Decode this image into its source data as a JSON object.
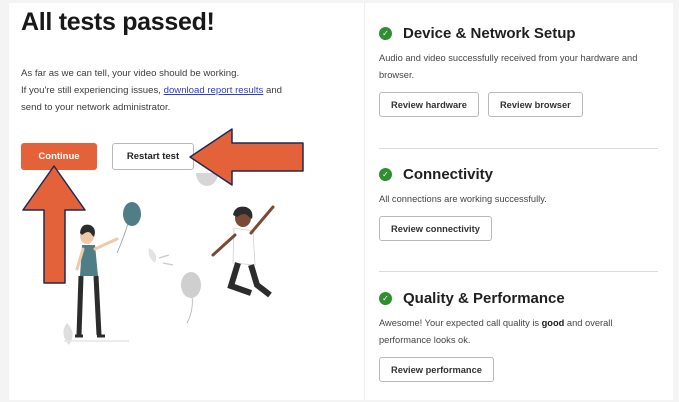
{
  "left": {
    "title": "All tests passed!",
    "desc_line1": "As far as we can tell, your video should be working.",
    "desc_line2_pre": "If you're still experiencing issues, ",
    "desc_link": "download report results",
    "desc_line2_post": " and send to your network administrator.",
    "continue_label": "Continue",
    "restart_label": "Restart test"
  },
  "sections": [
    {
      "title": "Device & Network Setup",
      "desc": "Audio and video successfully received from your hardware and browser.",
      "buttons": [
        "Review hardware",
        "Review browser"
      ]
    },
    {
      "title": "Connectivity",
      "desc": "All connections are working successfully.",
      "buttons": [
        "Review connectivity"
      ]
    },
    {
      "title": "Quality & Performance",
      "desc_pre": "Awesome! Your expected call quality is ",
      "desc_bold": "good",
      "desc_post": " and overall performance looks ok.",
      "buttons": [
        "Review performance"
      ]
    }
  ],
  "colors": {
    "accent": "#e4623a",
    "annotation_arrow": "#e4623a",
    "check": "#2f8f2f",
    "link": "#2b3fcf"
  },
  "icons": {
    "check": "check-circle-icon",
    "annotation": "arrow-icon"
  }
}
